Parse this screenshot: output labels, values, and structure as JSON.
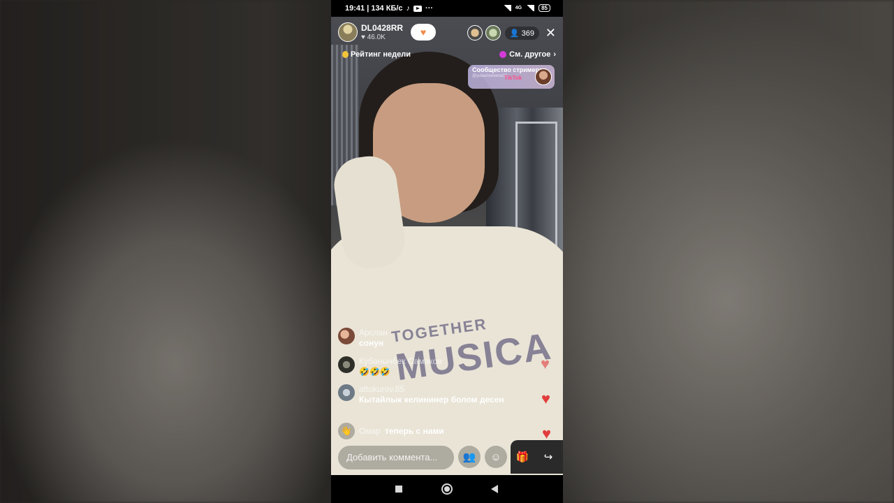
{
  "status_bar": {
    "time_speed": "19:41 | 134 КБ/с",
    "network": "4G",
    "battery": "85"
  },
  "host": {
    "name": "DL0428RR",
    "likes": "46.0K"
  },
  "viewers": {
    "count": "369"
  },
  "banners": {
    "rating": "Рейтинг недели",
    "see_other": "См. другое",
    "community_title": "Сообщество стримеров",
    "community_tag": "TikTok",
    "community_handle": "@yulaanneeeva02"
  },
  "chat": [
    {
      "name": "Арслан",
      "text": "сонун"
    },
    {
      "name": "Кубанычбек Самаков",
      "text": "🤣🤣🤣"
    },
    {
      "name": "attokurov.85",
      "text": "Кытайлык келининер болом десен"
    }
  ],
  "join_notice": {
    "name": "Омар",
    "text": "теперь с нами"
  },
  "comment": {
    "placeholder": "Добавить коммента..."
  },
  "video_print": {
    "line1": "TOGETHER",
    "line2": "MUSICA"
  },
  "colors": {
    "heart": "#e23c3c",
    "follow_accent": "#f08c4a"
  }
}
